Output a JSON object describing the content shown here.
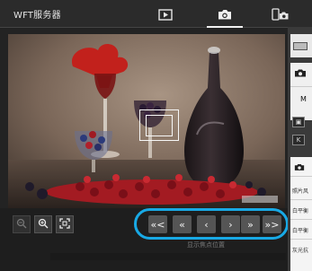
{
  "app": {
    "title": "WFT服务器"
  },
  "tabs": [
    {
      "name": "playback",
      "icon": "play-icon"
    },
    {
      "name": "remote-shooting",
      "icon": "camera-icon",
      "active": true
    },
    {
      "name": "device",
      "icon": "phone-camera-icon"
    }
  ],
  "zoom_tools": [
    {
      "icon": "zoom-out-icon",
      "glyph": "🔍︎",
      "enabled": false
    },
    {
      "icon": "zoom-in-icon",
      "glyph": "⊕",
      "enabled": true
    },
    {
      "icon": "fit-frame-icon",
      "glyph": "⌗",
      "enabled": true
    }
  ],
  "focus_nav": [
    {
      "name": "move-far-left",
      "label": "«<"
    },
    {
      "name": "move-left-fast",
      "label": "«"
    },
    {
      "name": "move-left",
      "label": "‹"
    },
    {
      "name": "move-right",
      "label": "›"
    },
    {
      "name": "move-right-fast",
      "label": "»"
    },
    {
      "name": "move-far-right",
      "label": "»>"
    }
  ],
  "hint": "显示焦点位置",
  "right_panel": {
    "labels": [
      "照片风",
      "白平衡",
      "白平衡",
      "灰光抗"
    ],
    "letters": [
      "M",
      "K"
    ]
  },
  "colors": {
    "accent": "#18a9e5",
    "background": "#232323"
  }
}
